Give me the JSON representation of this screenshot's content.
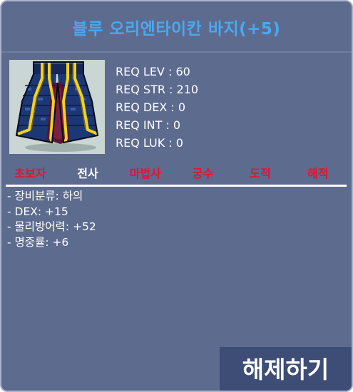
{
  "item": {
    "name": "블루 오리엔타이칸 바지(+5)",
    "name_color": "#4aa8f0",
    "icon": "blue-pants-icon"
  },
  "requirements": [
    "REQ LEV : 60",
    "REQ STR : 210",
    "REQ DEX : 0",
    "REQ INT : 0",
    "REQ LUK : 0"
  ],
  "jobs": [
    {
      "label": "초보자",
      "color": "#e8112d"
    },
    {
      "label": "전사",
      "color": "#ffffff"
    },
    {
      "label": "마법사",
      "color": "#e8112d"
    },
    {
      "label": "궁수",
      "color": "#e8112d"
    },
    {
      "label": "도적",
      "color": "#e8112d"
    },
    {
      "label": "해적",
      "color": "#e8112d"
    }
  ],
  "stats": [
    "- 장비분류: 하의",
    "- DEX: +15",
    "- 물리방어력: +52",
    "- 명중률: +6"
  ],
  "actions": {
    "unseal_label": "해제하기"
  }
}
